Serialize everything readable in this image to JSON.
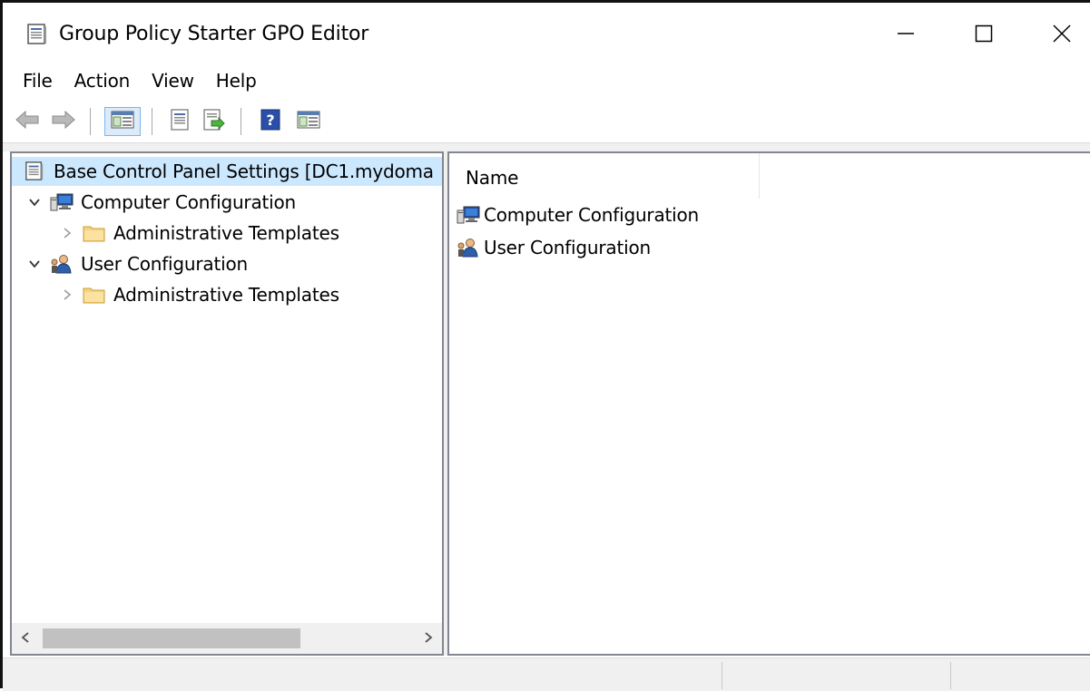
{
  "window": {
    "title": "Group Policy Starter GPO Editor",
    "icon": "gpo-document-icon",
    "controls": [
      "minimize-icon",
      "maximize-icon",
      "close-icon"
    ]
  },
  "menu": {
    "items": [
      "File",
      "Action",
      "View",
      "Help"
    ]
  },
  "toolbar": {
    "buttons": [
      "back-arrow-icon",
      "forward-arrow-icon",
      "show-hide-console-tree-icon",
      "properties-icon",
      "export-list-icon",
      "help-icon",
      "show-hide-action-pane-icon"
    ]
  },
  "tree": {
    "root": "Base Control Panel Settings [DC1.mydoma",
    "computer_config": "Computer Configuration",
    "computer_admin_templates": "Administrative Templates",
    "user_config": "User Configuration",
    "user_admin_templates": "Administrative Templates"
  },
  "list": {
    "column_name": "Name",
    "items": [
      "Computer Configuration",
      "User Configuration"
    ]
  },
  "colors": {
    "selection": "#cce8ff",
    "folder": "#f5d27a",
    "pane_border": "#828790",
    "chrome": "#f0f0f0"
  }
}
